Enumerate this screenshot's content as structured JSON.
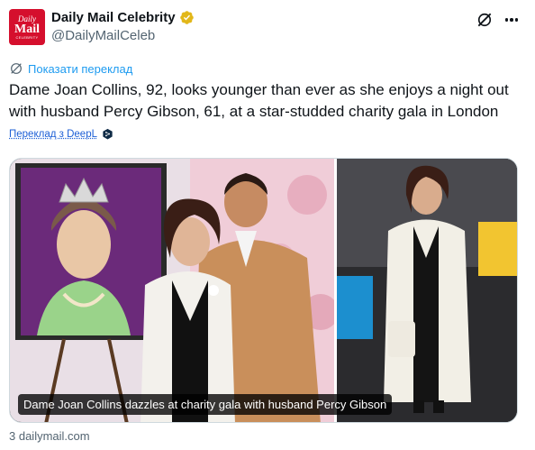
{
  "account": {
    "avatar_line1": "Daily",
    "avatar_line2": "Mail",
    "avatar_line3": "CELEBRITY",
    "display_name": "Daily Mail Celebrity",
    "handle": "@DailyMailCeleb",
    "verified": true,
    "verified_badge_color": "#e2b719"
  },
  "translate": {
    "show_translation_label": "Показати переклад",
    "icon": "globe-translate-icon"
  },
  "tweet": {
    "text": "Dame Joan Collins, 92, looks younger than ever as she enjoys a night out with husband Percy Gibson, 61, at a star-studded charity gala in London",
    "deepl_label": "Переклад з DeepL",
    "deepl_icon": "deepl-icon"
  },
  "media": {
    "caption": "Dame Joan Collins dazzles at charity gala with husband Percy Gibson",
    "left_image": "couple-at-gala-photo",
    "right_image": "joan-collins-street-photo"
  },
  "card": {
    "source_domain": "3 dailymail.com"
  },
  "colors": {
    "accent": "#1d9bf0",
    "brand_red": "#d50f2d",
    "muted": "#536471"
  }
}
